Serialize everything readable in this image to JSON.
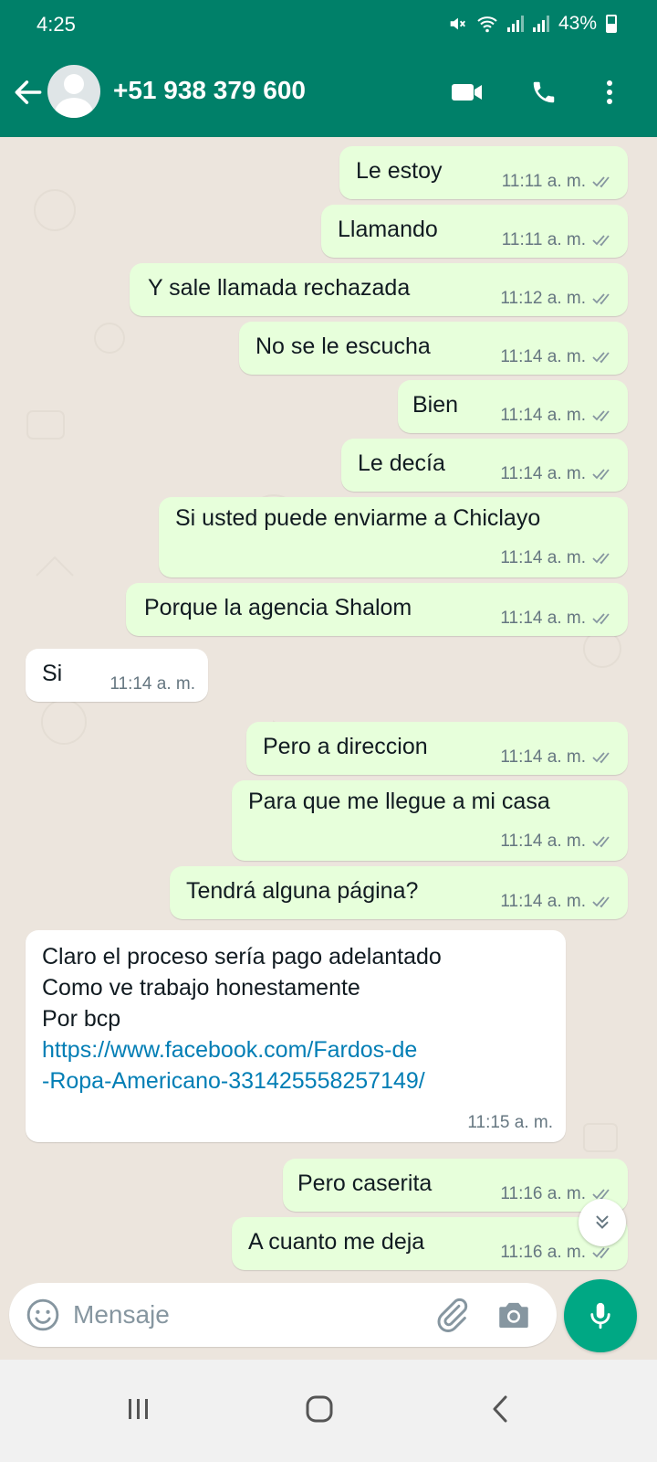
{
  "status_bar": {
    "time": "4:25",
    "battery": "43%"
  },
  "header": {
    "contact_name": "+51 938 379 600",
    "icons": [
      "back-arrow-icon",
      "avatar",
      "video-call-icon",
      "voice-call-icon",
      "more-options-icon"
    ]
  },
  "messages": [
    {
      "dir": "out",
      "text": "Le estoy",
      "time": "11:11 a. m.",
      "status": "read"
    },
    {
      "dir": "out",
      "text": "Llamando",
      "time": "11:11 a. m.",
      "status": "read"
    },
    {
      "dir": "out",
      "text": "Y sale llamada rechazada",
      "time": "11:12 a. m.",
      "status": "read"
    },
    {
      "dir": "out",
      "text": "No se le escucha",
      "time": "11:14 a. m.",
      "status": "read"
    },
    {
      "dir": "out",
      "text": "Bien",
      "time": "11:14 a. m.",
      "status": "read"
    },
    {
      "dir": "out",
      "text": "Le decía",
      "time": "11:14 a. m.",
      "status": "read"
    },
    {
      "dir": "out",
      "text": "Si usted puede enviarme a Chiclayo",
      "time": "11:14 a. m.",
      "status": "read"
    },
    {
      "dir": "out",
      "text": "Porque la agencia Shalom",
      "time": "11:14 a. m.",
      "status": "read"
    },
    {
      "dir": "in",
      "text": "Si",
      "time": "11:14 a. m."
    },
    {
      "dir": "out",
      "text": "Pero a direccion",
      "time": "11:14 a. m.",
      "status": "read"
    },
    {
      "dir": "out",
      "text": "Para que me llegue a mi casa",
      "time": "11:14 a. m.",
      "status": "read"
    },
    {
      "dir": "out",
      "text": "Tendrá alguna página?",
      "time": "11:14 a. m.",
      "status": "read"
    },
    {
      "dir": "in",
      "lines": [
        "Claro el proceso sería pago adelantado",
        "Como ve trabajo honestamente",
        "Por bcp"
      ],
      "link_lines": [
        "https://www.facebook.com/Fardos-de",
        "-Ropa-Americano-331425558257149/"
      ],
      "time": "11:15 a. m."
    },
    {
      "dir": "out",
      "text": "Pero caserita",
      "time": "11:16 a. m.",
      "status": "read"
    },
    {
      "dir": "out",
      "text": "A cuanto me deja",
      "time": "11:16 a. m.",
      "status": "read"
    }
  ],
  "composer": {
    "placeholder": "Mensaje",
    "value": ""
  },
  "colors": {
    "header": "#008069",
    "outgoing_bubble": "#e7ffdb",
    "incoming_bubble": "#ffffff",
    "chat_bg": "#ece5dd",
    "read_ticks": "#8696a0",
    "link": "#027eb5",
    "mic_button": "#00a884"
  }
}
